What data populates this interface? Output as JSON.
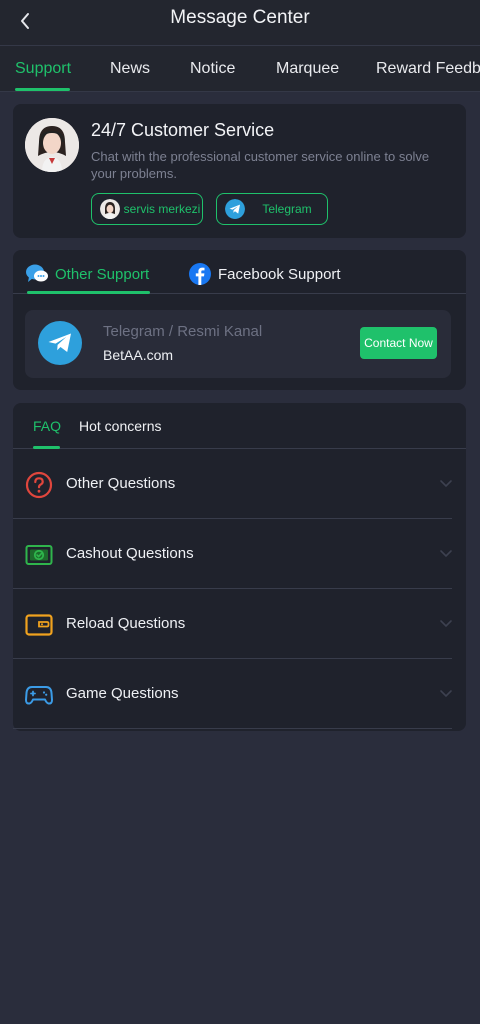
{
  "header": {
    "title": "Message Center"
  },
  "tabs": [
    {
      "label": "Support",
      "active": true
    },
    {
      "label": "News",
      "active": false
    },
    {
      "label": "Notice",
      "active": false
    },
    {
      "label": "Marquee",
      "active": false
    },
    {
      "label": "Reward Feedb",
      "active": false
    }
  ],
  "customer_service": {
    "title": "24/7 Customer Service",
    "description": "Chat with the professional customer service online to solve your problems.",
    "buttons": [
      {
        "label": "servis merkezi"
      },
      {
        "label": "Telegram"
      }
    ]
  },
  "support_tabs": [
    {
      "label": "Other Support",
      "active": true
    },
    {
      "label": "Facebook Support",
      "active": false
    }
  ],
  "telegram_channel": {
    "name": "Telegram / Resmi Kanal",
    "site": "BetAA.com",
    "button_label": "Contact Now"
  },
  "faq_tabs": [
    {
      "label": "FAQ",
      "active": true
    },
    {
      "label": "Hot concerns",
      "active": false
    }
  ],
  "questions": [
    {
      "label": "Other Questions",
      "icon": "question-icon"
    },
    {
      "label": "Cashout Questions",
      "icon": "cashout-icon"
    },
    {
      "label": "Reload Questions",
      "icon": "wallet-icon"
    },
    {
      "label": "Game Questions",
      "icon": "gamepad-icon"
    }
  ],
  "colors": {
    "accent": "#1fc16b",
    "background": "#2a2d3c",
    "card": "#1f222c",
    "telegram": "#2ea0dc",
    "facebook": "#1877f2"
  }
}
